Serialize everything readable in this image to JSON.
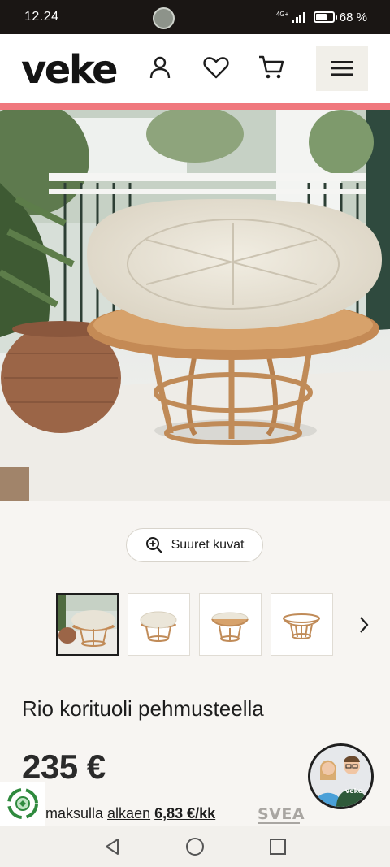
{
  "status_bar": {
    "time": "12.24",
    "network": "4G+",
    "battery": "68 %",
    "battery_level": 0.68,
    "icons": [
      "gallery-notification-icon",
      "signal-icon",
      "battery-icon"
    ]
  },
  "header": {
    "logo": "veke",
    "icons": [
      "user-icon",
      "heart-icon",
      "cart-icon",
      "menu-icon"
    ],
    "accent_color": "#f0787e"
  },
  "gallery": {
    "zoom_label": "Suuret kuvat",
    "zoom_icon": "zoom-in-icon",
    "thumbnail_count": 4,
    "active_thumbnail": 1,
    "next_icon": "chevron-right-icon"
  },
  "product": {
    "title": "Rio korituoli pehmusteella",
    "price": "235 €",
    "installment_prefix": "maksulla",
    "installment_from": "alkaen",
    "installment_amount": "6,83 €/kk",
    "provider": "SVEA"
  },
  "overlays": {
    "eco_badge_icon": "recycle-icon",
    "chat_avatar": "veke"
  },
  "nav": {
    "icons": [
      "back-icon",
      "home-icon",
      "recents-icon"
    ]
  }
}
